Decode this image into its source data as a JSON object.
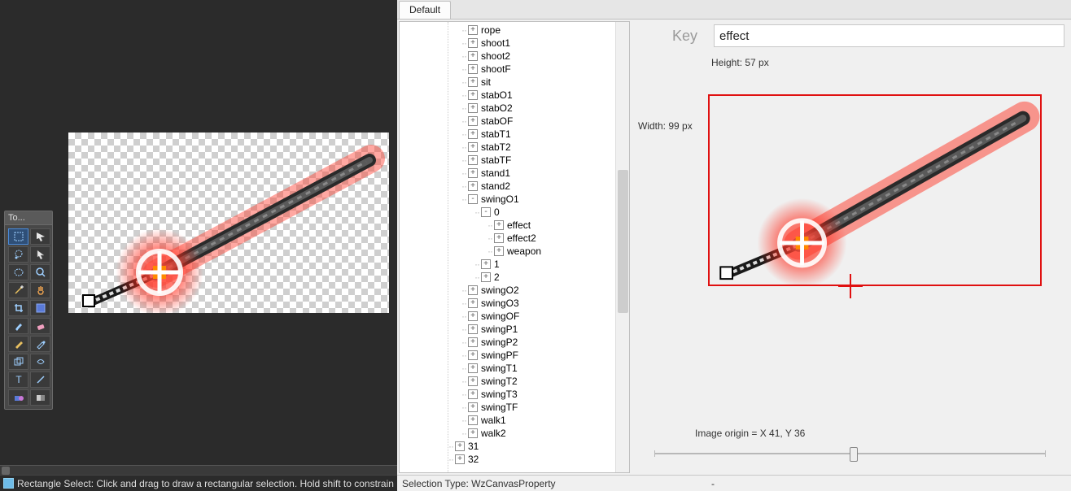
{
  "editor": {
    "toolbox_title": "To...",
    "status_text": "Rectangle Select: Click and drag to draw a rectangular selection. Hold shift to constrain",
    "tools": [
      "rect-select",
      "move-select",
      "lasso",
      "pointer",
      "ellipse-select",
      "zoom",
      "magic-wand",
      "pan",
      "crop",
      "fill",
      "brush",
      "eraser",
      "pencil",
      "color-picker",
      "clone",
      "recolor",
      "text",
      "line",
      "shapes",
      "gradient"
    ]
  },
  "right": {
    "tab_label": "Default",
    "key_label": "Key",
    "key_value": "effect",
    "height_label": "Height: 57 px",
    "width_label": "Width: 99 px",
    "origin_label": "Image origin =   X 41, Y 36",
    "status_type_label": "Selection Type:  WzCanvasProperty",
    "status_dash": "-",
    "tree": [
      {
        "d": 1,
        "t": "+",
        "l": "rope"
      },
      {
        "d": 1,
        "t": "+",
        "l": "shoot1"
      },
      {
        "d": 1,
        "t": "+",
        "l": "shoot2"
      },
      {
        "d": 1,
        "t": "+",
        "l": "shootF"
      },
      {
        "d": 1,
        "t": "+",
        "l": "sit"
      },
      {
        "d": 1,
        "t": "+",
        "l": "stabO1"
      },
      {
        "d": 1,
        "t": "+",
        "l": "stabO2"
      },
      {
        "d": 1,
        "t": "+",
        "l": "stabOF"
      },
      {
        "d": 1,
        "t": "+",
        "l": "stabT1"
      },
      {
        "d": 1,
        "t": "+",
        "l": "stabT2"
      },
      {
        "d": 1,
        "t": "+",
        "l": "stabTF"
      },
      {
        "d": 1,
        "t": "+",
        "l": "stand1"
      },
      {
        "d": 1,
        "t": "+",
        "l": "stand2"
      },
      {
        "d": 1,
        "t": "-",
        "l": "swingO1"
      },
      {
        "d": 2,
        "t": "-",
        "l": "0"
      },
      {
        "d": 3,
        "t": "+",
        "l": "effect"
      },
      {
        "d": 3,
        "t": "+",
        "l": "effect2"
      },
      {
        "d": 3,
        "t": "+",
        "l": "weapon"
      },
      {
        "d": 2,
        "t": "+",
        "l": "1"
      },
      {
        "d": 2,
        "t": "+",
        "l": "2"
      },
      {
        "d": 1,
        "t": "+",
        "l": "swingO2"
      },
      {
        "d": 1,
        "t": "+",
        "l": "swingO3"
      },
      {
        "d": 1,
        "t": "+",
        "l": "swingOF"
      },
      {
        "d": 1,
        "t": "+",
        "l": "swingP1"
      },
      {
        "d": 1,
        "t": "+",
        "l": "swingP2"
      },
      {
        "d": 1,
        "t": "+",
        "l": "swingPF"
      },
      {
        "d": 1,
        "t": "+",
        "l": "swingT1"
      },
      {
        "d": 1,
        "t": "+",
        "l": "swingT2"
      },
      {
        "d": 1,
        "t": "+",
        "l": "swingT3"
      },
      {
        "d": 1,
        "t": "+",
        "l": "swingTF"
      },
      {
        "d": 1,
        "t": "+",
        "l": "walk1"
      },
      {
        "d": 1,
        "t": "+",
        "l": "walk2"
      },
      {
        "d": 0,
        "t": "+",
        "l": "31"
      },
      {
        "d": 0,
        "t": "+",
        "l": "32"
      }
    ]
  }
}
